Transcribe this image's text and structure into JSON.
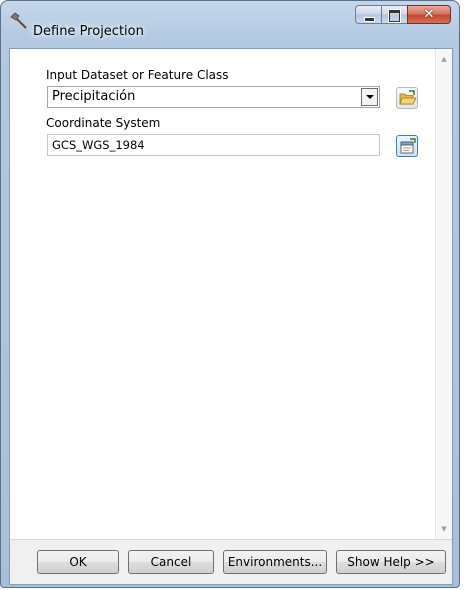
{
  "window": {
    "title": "Define Projection",
    "app_icon": "hammer-icon",
    "caption_buttons": [
      "minimize-icon",
      "maximize-icon",
      "close-icon"
    ]
  },
  "form": {
    "input_dataset": {
      "label": "Input Dataset or Feature Class",
      "value": "Precipitación",
      "browse_icon": "open-folder-icon"
    },
    "coordinate_system": {
      "label": "Coordinate System",
      "value": "GCS_WGS_1984",
      "properties_icon": "spatial-reference-properties-icon"
    }
  },
  "buttons": {
    "ok": "OK",
    "cancel": "Cancel",
    "environments": "Environments...",
    "show_help": "Show Help >>"
  },
  "colors": {
    "frame": "#b3c9e2",
    "close_button": "#c3462e",
    "dialog_background": "#f0f0f0"
  }
}
